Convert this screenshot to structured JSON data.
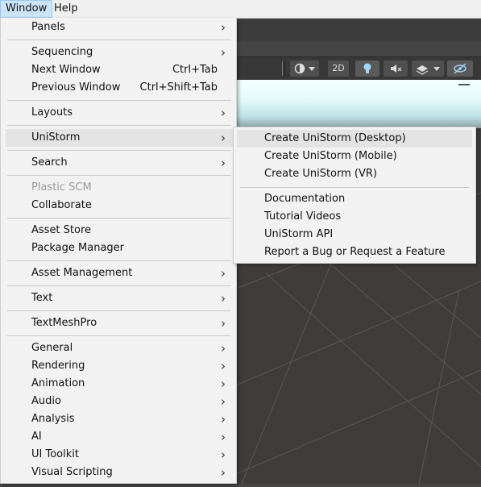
{
  "menubar": {
    "window": "Window",
    "help": "Help"
  },
  "toolbar": {
    "btn_2d": "2D"
  },
  "menu": {
    "panels": "Panels",
    "sequencing": "Sequencing",
    "next_window": "Next Window",
    "next_window_shortcut": "Ctrl+Tab",
    "previous_window": "Previous Window",
    "previous_window_shortcut": "Ctrl+Shift+Tab",
    "layouts": "Layouts",
    "unistorm": "UniStorm",
    "search": "Search",
    "plastic_scm": "Plastic SCM",
    "collaborate": "Collaborate",
    "asset_store": "Asset Store",
    "package_manager": "Package Manager",
    "asset_management": "Asset Management",
    "text": "Text",
    "textmeshpro": "TextMeshPro",
    "general": "General",
    "rendering": "Rendering",
    "animation": "Animation",
    "audio": "Audio",
    "analysis": "Analysis",
    "ai": "AI",
    "ui_toolkit": "UI Toolkit",
    "visual_scripting": "Visual Scripting",
    "arrow": "›"
  },
  "submenu": {
    "create_desktop": "Create UniStorm (Desktop)",
    "create_mobile": "Create UniStorm (Mobile)",
    "create_vr": "Create UniStorm (VR)",
    "documentation": "Documentation",
    "tutorial_videos": "Tutorial Videos",
    "unistorm_api": "UniStorm API",
    "report_bug": "Report a Bug or Request a Feature"
  }
}
